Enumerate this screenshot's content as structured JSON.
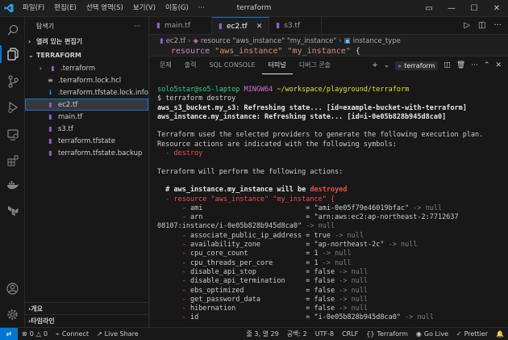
{
  "titlebar": {
    "menu": [
      "파일(F)",
      "편집(E)",
      "선택 영역(S)",
      "보기(V)",
      "이동(G)",
      "···"
    ],
    "title": "terraform"
  },
  "sidebar": {
    "header": "탐색기",
    "more": "···",
    "open_editors": "열려 있는 편집기",
    "project": "TERRAFORM",
    "files": [
      {
        "name": ".terraform",
        "type": "folder"
      },
      {
        "name": ".terraform.lock.hcl",
        "type": "hcl"
      },
      {
        "name": ".terraform.tfstate.lock.info",
        "type": "info"
      },
      {
        "name": "ec2.tf",
        "type": "tf",
        "selected": true
      },
      {
        "name": "main.tf",
        "type": "tf"
      },
      {
        "name": "s3.tf",
        "type": "tf"
      },
      {
        "name": "terraform.tfstate",
        "type": "tf"
      },
      {
        "name": "terraform.tfstate.backup",
        "type": "tf"
      }
    ],
    "outline": "개요",
    "timeline": "타임라인"
  },
  "tabs": [
    {
      "label": "main.tf",
      "active": false
    },
    {
      "label": "ec2.tf",
      "active": true
    },
    {
      "label": "s3.tf",
      "active": false
    }
  ],
  "breadcrumb": [
    "ec2.tf",
    "resource \"aws_instance\" \"my_instance\"",
    "instance_type"
  ],
  "code_line": {
    "keyword": "resource",
    "type": "\"aws_instance\"",
    "name": "\"my_instance\"",
    "brace": "{"
  },
  "panel": {
    "tabs": [
      "문제",
      "출력",
      "SQL CONSOLE",
      "터미널",
      "디버그 콘솔"
    ],
    "active_tab": "터미널",
    "terminal_name": "terraform"
  },
  "terminal": {
    "prompt_user": "solo5star@so5-laptop",
    "prompt_shell": "MINGW64",
    "prompt_path": "~/workspace/playground/terraform",
    "command": "$ terraform destroy",
    "refresh1": "aws_s3_bucket.my_s3: Refreshing state... [id=example-bucket-with-terraform]",
    "refresh2": "aws_instance.my_instance: Refreshing state... [id=i-0e05b828b945d8ca0]",
    "plan1": "Terraform used the selected providers to generate the following execution plan.",
    "plan2": "Resource actions are indicated with the following symbols:",
    "plan3": "  - destroy",
    "perform": "Terraform will perform the following actions:",
    "res_comment": "  # aws_instance.my_instance",
    "res_will": " will be ",
    "res_destroyed": "destroyed",
    "res_line": "  - resource \"aws_instance\" \"my_instance\" {",
    "attrs": [
      {
        "key": "ami",
        "val": "\"ami-0e05f79e46019bfac\"",
        "kind": "str"
      },
      {
        "key": "arn",
        "val": "\"arn:aws:ec2:ap-northeast-2:7712637",
        "kind": "str"
      }
    ],
    "arn_cont": "08107:instance/i-0e05b828b945d8ca0\"",
    "attrs2": [
      {
        "key": "associate_public_ip_address",
        "val": "true",
        "kind": "bool"
      },
      {
        "key": "availability_zone",
        "val": "\"ap-northeast-2c\"",
        "kind": "str"
      },
      {
        "key": "cpu_core_count",
        "val": "1",
        "kind": "num"
      },
      {
        "key": "cpu_threads_per_core",
        "val": "1",
        "kind": "num"
      },
      {
        "key": "disable_api_stop",
        "val": "false",
        "kind": "bool"
      },
      {
        "key": "disable_api_termination",
        "val": "false",
        "kind": "bool"
      },
      {
        "key": "ebs_optimized",
        "val": "false",
        "kind": "bool"
      },
      {
        "key": "get_password_data",
        "val": "false",
        "kind": "bool"
      },
      {
        "key": "hibernation",
        "val": "false",
        "kind": "bool"
      },
      {
        "key": "id",
        "val": "\"i-0e05b828b945d8ca0\"",
        "kind": "str"
      }
    ],
    "arrow": "->",
    "null": "null"
  },
  "statusbar": {
    "errors": "0",
    "warnings": "0",
    "connect": "Connect",
    "live_share": "Live Share",
    "position": "줄 3, 열 29",
    "spaces": "공백: 2",
    "encoding": "UTF-8",
    "eol": "CRLF",
    "braces": "{}",
    "language": "Terraform",
    "go_live": "Go Live",
    "prettier": "Prettier"
  },
  "colors": {
    "accent": "#0078d4",
    "prompt_green": "#23d18b",
    "prompt_path_yellow": "#e5e510",
    "destroyed_orange": "#e0a06a"
  }
}
